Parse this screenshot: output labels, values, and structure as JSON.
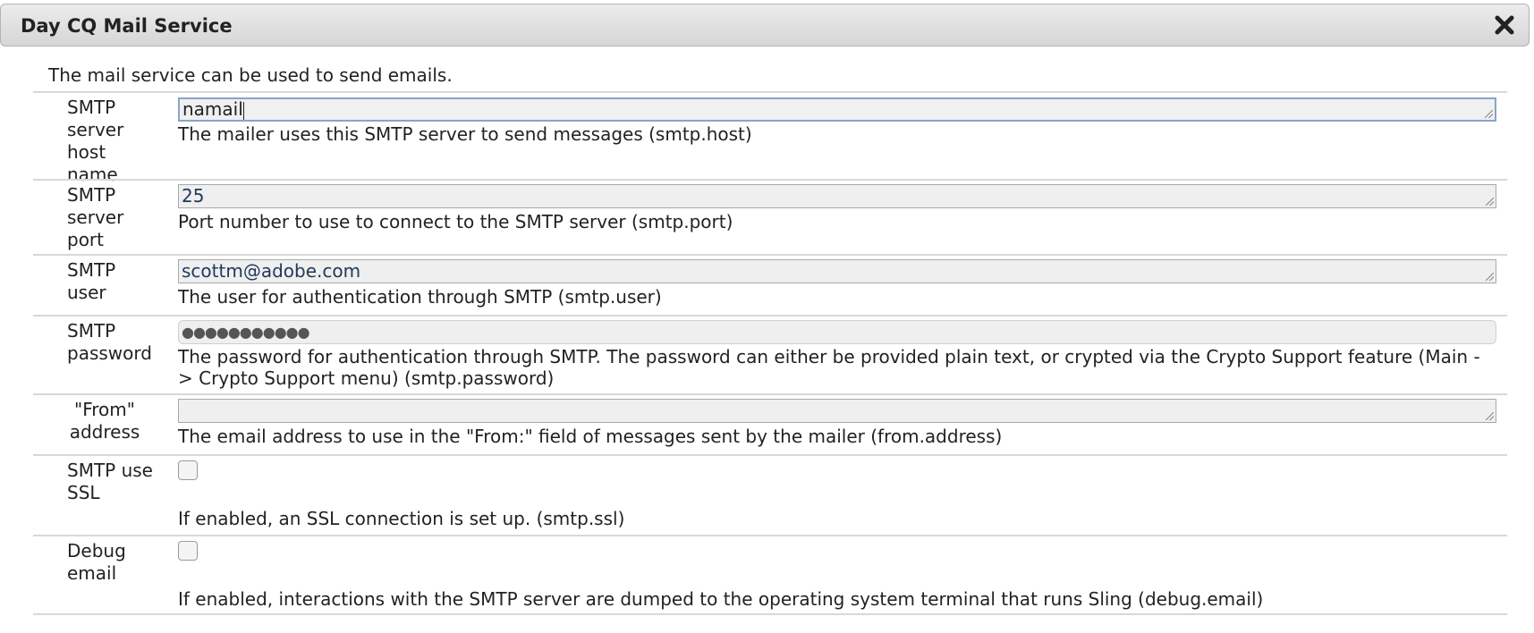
{
  "dialog": {
    "title": "Day CQ Mail Service",
    "close_icon": "close-icon"
  },
  "intro": "The mail service can be used to send emails.",
  "fields": {
    "smtp_host": {
      "label": "SMTP server host name",
      "value": "namail",
      "description": "The mailer uses this SMTP server to send messages (smtp.host)"
    },
    "smtp_port": {
      "label": "SMTP server port",
      "value": "25",
      "description": "Port number to use to connect to the SMTP server (smtp.port)"
    },
    "smtp_user": {
      "label": "SMTP user",
      "value": "scottm@adobe.com",
      "description": "The user for authentication through SMTP (smtp.user)"
    },
    "smtp_password": {
      "label": "SMTP password",
      "value": "●●●●●●●●●●●",
      "description": "The password for authentication through SMTP. The password can either be provided plain text, or crypted via the Crypto Support feature (Main -> Crypto Support menu) (smtp.password)"
    },
    "from_address": {
      "label": "\"From\" address",
      "value": "",
      "description": "The email address to use in the \"From:\" field of messages sent by the mailer (from.address)"
    },
    "smtp_ssl": {
      "label": "SMTP use SSL",
      "checked": false,
      "description": "If enabled, an SSL connection is set up. (smtp.ssl)"
    },
    "debug_email": {
      "label": "Debug email",
      "checked": false,
      "description": "If enabled, interactions with the SMTP server are dumped to the operating system terminal that runs Sling (debug.email)"
    }
  }
}
